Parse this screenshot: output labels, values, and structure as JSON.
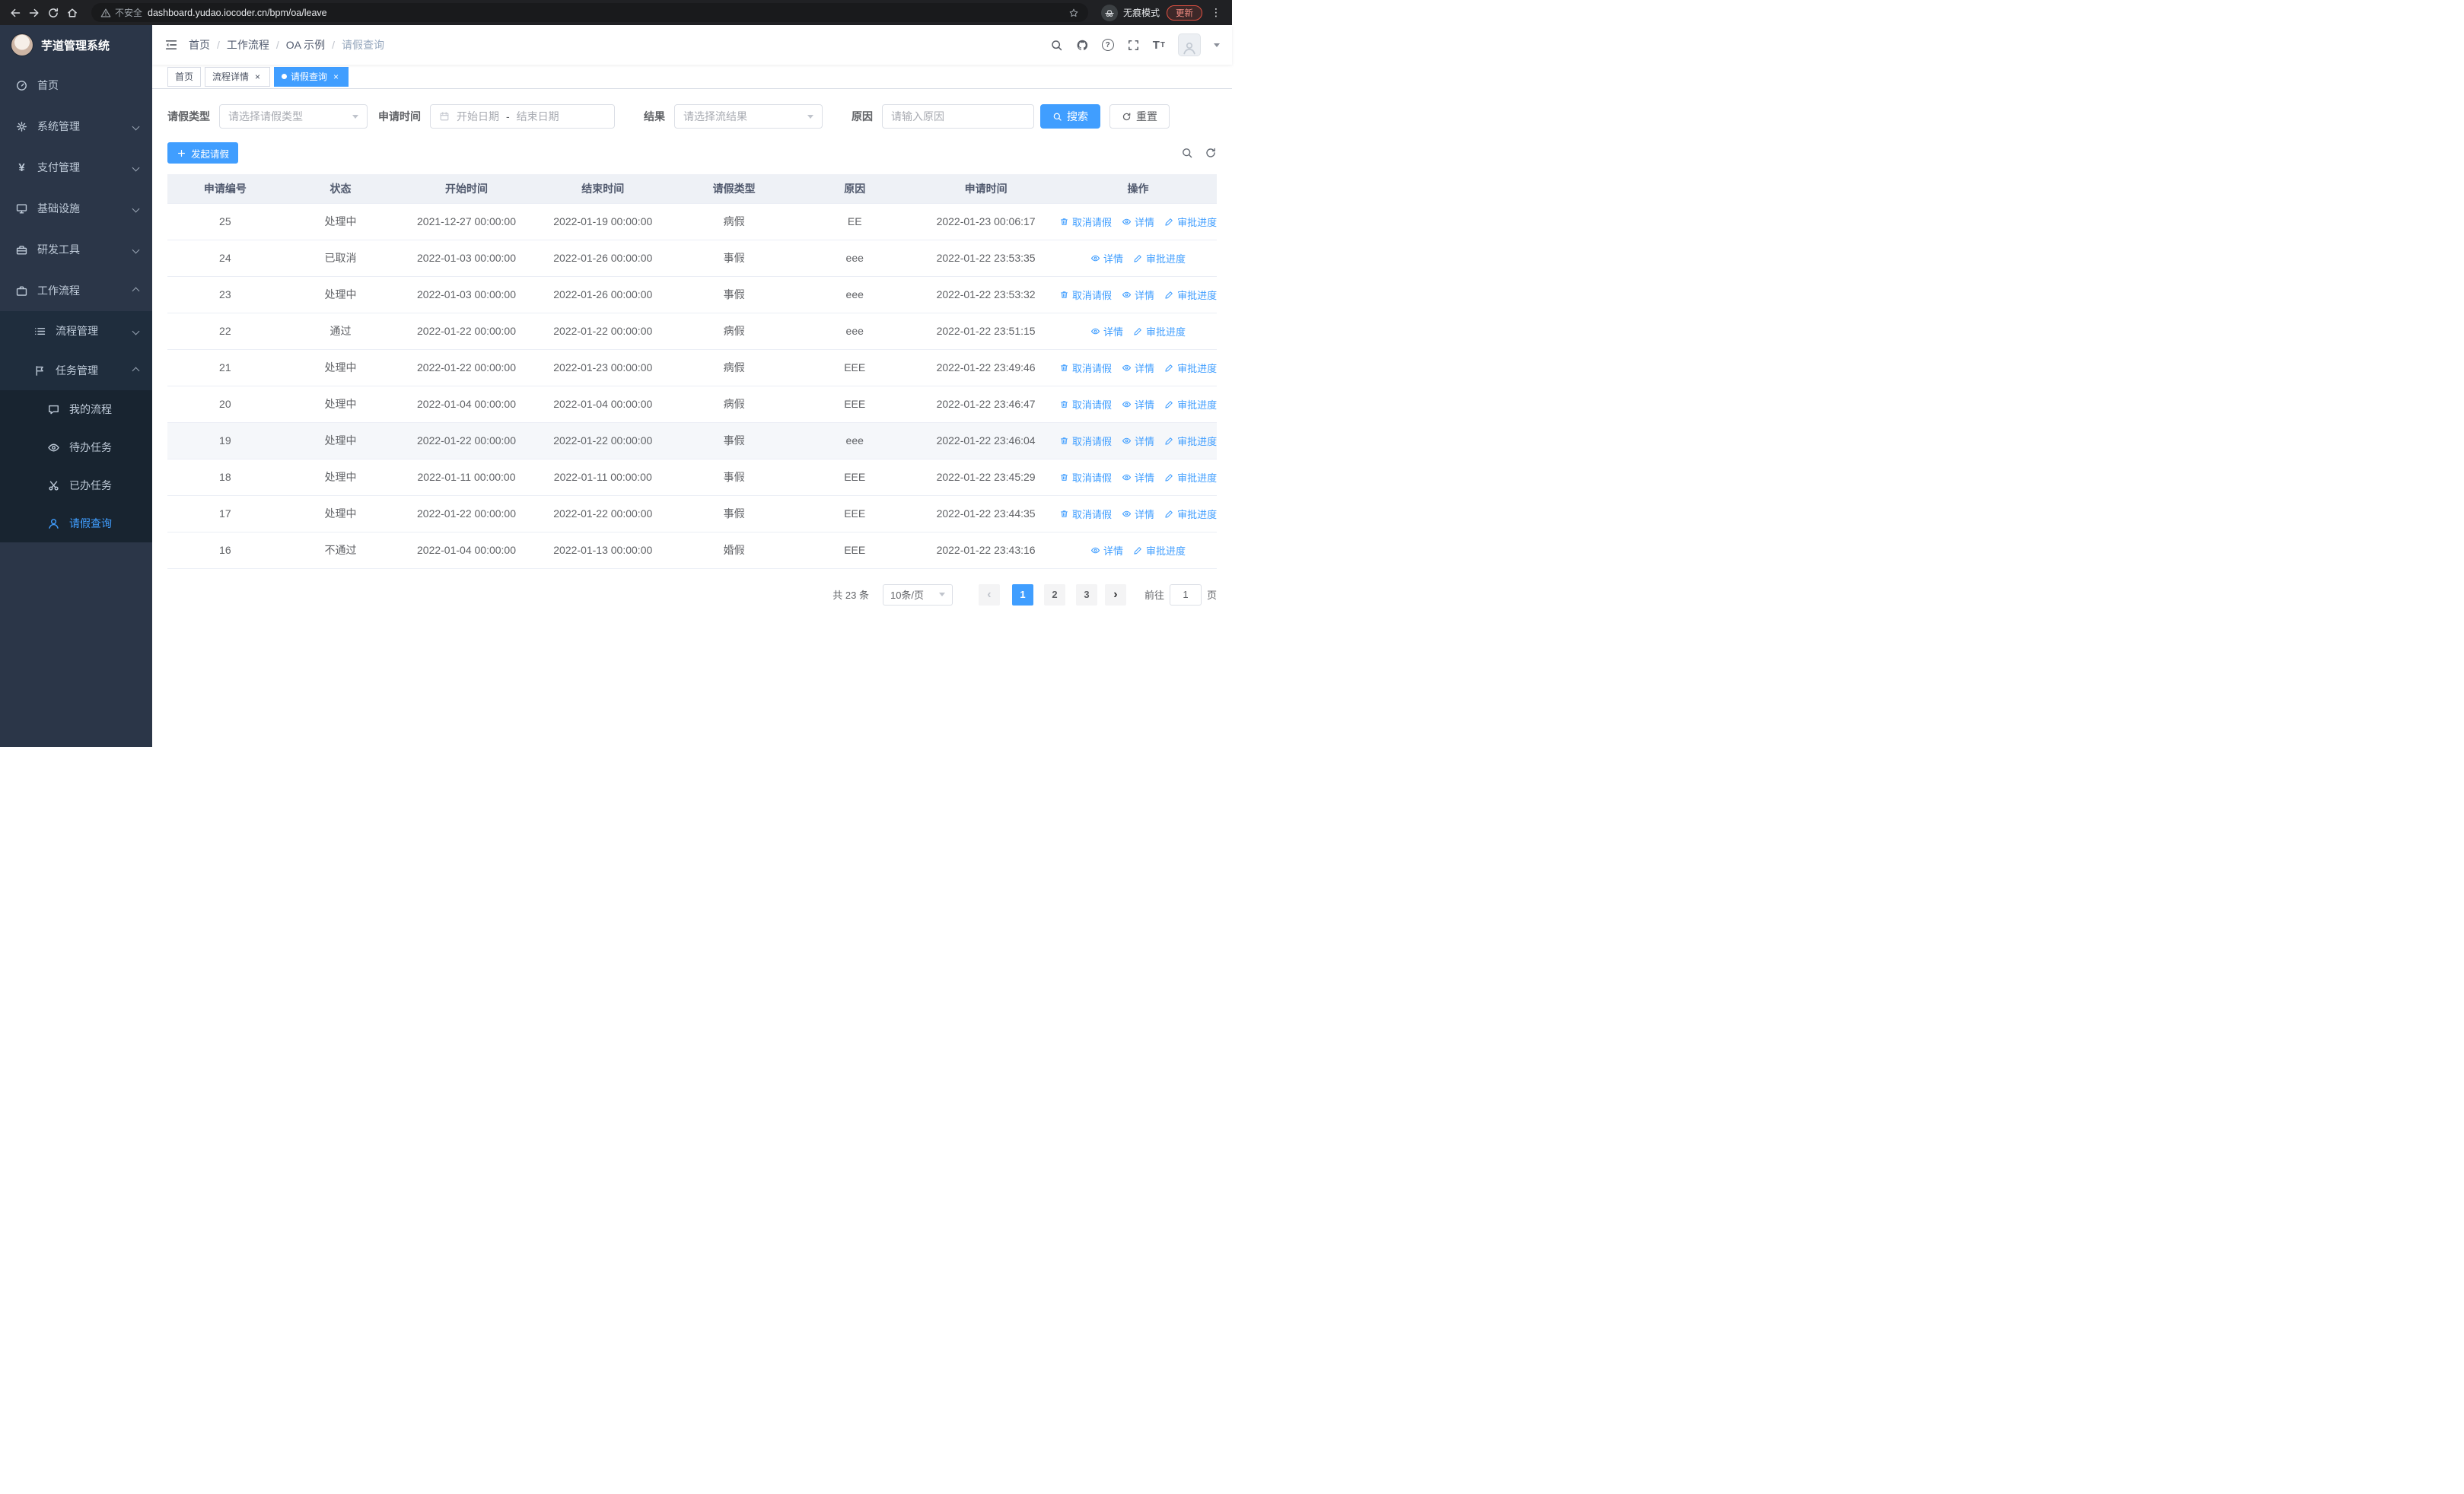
{
  "colors": {
    "accent": "#409eff",
    "sidebar_bg": "#2b3648",
    "sidebar_sub_bg": "#1f2d3d",
    "sidebar_text": "#bfcbd9",
    "danger": "#e25142"
  },
  "icons": {
    "yen": "¥",
    "dots": "⋮",
    "question": "?",
    "font_t": "T",
    "close": "×",
    "breadcrumb_separator": "/"
  },
  "browser": {
    "security_label": "不安全",
    "url": "dashboard.yudao.iocoder.cn/bpm/oa/leave",
    "incognito_label": "无痕模式",
    "update_label": "更新"
  },
  "sidebar": {
    "logo_title": "芋道管理系统",
    "items": [
      {
        "label": "首页"
      },
      {
        "label": "系统管理"
      },
      {
        "label": "支付管理"
      },
      {
        "label": "基础设施"
      },
      {
        "label": "研发工具"
      },
      {
        "label": "工作流程"
      },
      {
        "label": "流程管理"
      },
      {
        "label": "任务管理"
      },
      {
        "label": "我的流程"
      },
      {
        "label": "待办任务"
      },
      {
        "label": "已办任务"
      },
      {
        "label": "请假查询"
      }
    ]
  },
  "breadcrumb": [
    "首页",
    "工作流程",
    "OA 示例",
    "请假查询"
  ],
  "tabs": [
    {
      "label": "首页"
    },
    {
      "label": "流程详情"
    },
    {
      "label": "请假查询"
    }
  ],
  "filters": {
    "type_label": "请假类型",
    "type_placeholder": "请选择请假类型",
    "time_label": "申请时间",
    "start_placeholder": "开始日期",
    "separator": "-",
    "end_placeholder": "结束日期",
    "result_label": "结果",
    "result_placeholder": "请选择流结果",
    "reason_label": "原因",
    "reason_placeholder": "请输入原因",
    "search_label": "搜索",
    "reset_label": "重置"
  },
  "toolbar": {
    "create_label": "发起请假"
  },
  "table": {
    "columns": [
      "申请编号",
      "状态",
      "开始时间",
      "结束时间",
      "请假类型",
      "原因",
      "申请时间",
      "操作"
    ],
    "action_labels": {
      "cancel": "取消请假",
      "detail": "详情",
      "progress": "审批进度"
    },
    "rows": [
      {
        "id": "25",
        "status": "处理中",
        "start": "2021-12-27 00:00:00",
        "end": "2022-01-19 00:00:00",
        "type": "病假",
        "reason": "EE",
        "applied": "2022-01-23 00:06:17",
        "has_cancel": true,
        "highlighted": false
      },
      {
        "id": "24",
        "status": "已取消",
        "start": "2022-01-03 00:00:00",
        "end": "2022-01-26 00:00:00",
        "type": "事假",
        "reason": "eee",
        "applied": "2022-01-22 23:53:35",
        "has_cancel": false,
        "highlighted": false
      },
      {
        "id": "23",
        "status": "处理中",
        "start": "2022-01-03 00:00:00",
        "end": "2022-01-26 00:00:00",
        "type": "事假",
        "reason": "eee",
        "applied": "2022-01-22 23:53:32",
        "has_cancel": true,
        "highlighted": false
      },
      {
        "id": "22",
        "status": "通过",
        "start": "2022-01-22 00:00:00",
        "end": "2022-01-22 00:00:00",
        "type": "病假",
        "reason": "eee",
        "applied": "2022-01-22 23:51:15",
        "has_cancel": false,
        "highlighted": false
      },
      {
        "id": "21",
        "status": "处理中",
        "start": "2022-01-22 00:00:00",
        "end": "2022-01-23 00:00:00",
        "type": "病假",
        "reason": "EEE",
        "applied": "2022-01-22 23:49:46",
        "has_cancel": true,
        "highlighted": false
      },
      {
        "id": "20",
        "status": "处理中",
        "start": "2022-01-04 00:00:00",
        "end": "2022-01-04 00:00:00",
        "type": "病假",
        "reason": "EEE",
        "applied": "2022-01-22 23:46:47",
        "has_cancel": true,
        "highlighted": false
      },
      {
        "id": "19",
        "status": "处理中",
        "start": "2022-01-22 00:00:00",
        "end": "2022-01-22 00:00:00",
        "type": "事假",
        "reason": "eee",
        "applied": "2022-01-22 23:46:04",
        "has_cancel": true,
        "highlighted": true
      },
      {
        "id": "18",
        "status": "处理中",
        "start": "2022-01-11 00:00:00",
        "end": "2022-01-11 00:00:00",
        "type": "事假",
        "reason": "EEE",
        "applied": "2022-01-22 23:45:29",
        "has_cancel": true,
        "highlighted": false
      },
      {
        "id": "17",
        "status": "处理中",
        "start": "2022-01-22 00:00:00",
        "end": "2022-01-22 00:00:00",
        "type": "事假",
        "reason": "EEE",
        "applied": "2022-01-22 23:44:35",
        "has_cancel": true,
        "highlighted": false
      },
      {
        "id": "16",
        "status": "不通过",
        "start": "2022-01-04 00:00:00",
        "end": "2022-01-13 00:00:00",
        "type": "婚假",
        "reason": "EEE",
        "applied": "2022-01-22 23:43:16",
        "has_cancel": false,
        "highlighted": false
      }
    ]
  },
  "pagination": {
    "total": "共 23 条",
    "page_size": "10条/页",
    "prev": "‹",
    "next": "›",
    "pages": [
      "1",
      "2",
      "3"
    ],
    "active_page": "1",
    "goto_label": "前往",
    "goto_value": "1",
    "goto_suffix": "页"
  }
}
